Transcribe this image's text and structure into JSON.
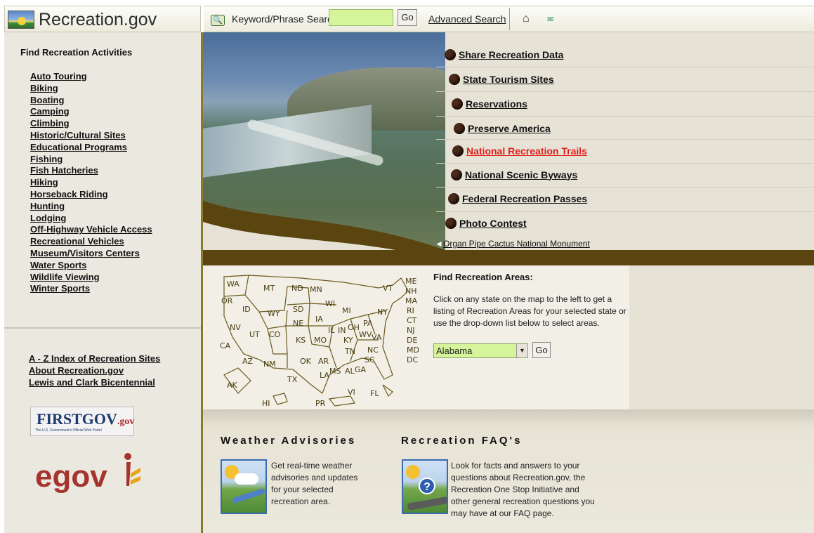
{
  "header": {
    "site_title": "Recreation.gov",
    "search_label": "Keyword/Phrase Search",
    "search_value": "",
    "go_label": "Go",
    "advanced_search_label": "Advanced Search",
    "home_icon": "home-icon",
    "email_icon": "email-icon"
  },
  "sidebar": {
    "title": "Find Recreation Activities",
    "activities": [
      "Auto Touring",
      "Biking",
      "Boating",
      "Camping",
      "Climbing",
      "Historic/Cultural Sites",
      "Educational Programs",
      "Fishing",
      "Fish Hatcheries",
      "Hiking",
      "Horseback Riding",
      "Hunting",
      "Lodging",
      "Off-Highway Vehicle Access",
      "Recreational Vehicles",
      "Museum/Visitors Centers",
      "Water Sports",
      "Wildlife Viewing",
      "Winter Sports"
    ],
    "links": [
      "A - Z Index of Recreation Sites",
      "About Recreation.gov",
      "Lewis and Clark Bicentennial"
    ],
    "firstgov_logo_text": "FIRSTGOV",
    "firstgov_logo_suffix": ".gov",
    "firstgov_tagline": "The U.S. Government's Official Web Portal",
    "egov_logo_text": "egov"
  },
  "feature_links": [
    {
      "label": "Share Recreation Data",
      "highlight": false
    },
    {
      "label": "State Tourism Sites",
      "highlight": false
    },
    {
      "label": "Reservations",
      "highlight": false
    },
    {
      "label": "Preserve America",
      "highlight": false
    },
    {
      "label": "National Recreation Trails",
      "highlight": true
    },
    {
      "label": "National Scenic Byways",
      "highlight": false
    },
    {
      "label": "Federal Recreation Passes",
      "highlight": false
    },
    {
      "label": "Photo Contest",
      "highlight": false
    }
  ],
  "photo_caption": "Organ Pipe Cactus National Monument",
  "map": {
    "states": [
      "WA",
      "MT",
      "ND",
      "MN",
      "OR",
      "ID",
      "SD",
      "WI",
      "WY",
      "IA",
      "NE",
      "MI",
      "NV",
      "UT",
      "CO",
      "IL",
      "IN",
      "OH",
      "PA",
      "NY",
      "CA",
      "KS",
      "MO",
      "KY",
      "WV",
      "VA",
      "AZ",
      "NM",
      "OK",
      "AR",
      "TN",
      "NC",
      "TX",
      "LA",
      "MS",
      "AL",
      "GA",
      "SC",
      "AK",
      "HI",
      "PR",
      "VI",
      "FL",
      "VT",
      "ME",
      "NH",
      "MA",
      "RI",
      "CT",
      "NJ",
      "DE",
      "MD",
      "DC"
    ]
  },
  "find_areas": {
    "title": "Find Recreation Areas:",
    "description": "Click on any state on the map to the left to get a listing of Recreation Areas for your selected state or use the drop-down list below to select areas.",
    "selected_state": "Alabama",
    "go_label": "Go"
  },
  "weather": {
    "title": "Weather Advisories",
    "text": "Get real-time weather advisories and updates for your selected recreation area."
  },
  "faq": {
    "title": "Recreation FAQ's",
    "text": "Look for facts and answers to your questions about Recreation.gov, the Recreation One Stop Initiative and other general recreation questions you may have at our FAQ page."
  },
  "colors": {
    "accent_green_input": "#d6f59a",
    "brown_band": "#5a4410",
    "highlight_link": "#e0201a"
  }
}
